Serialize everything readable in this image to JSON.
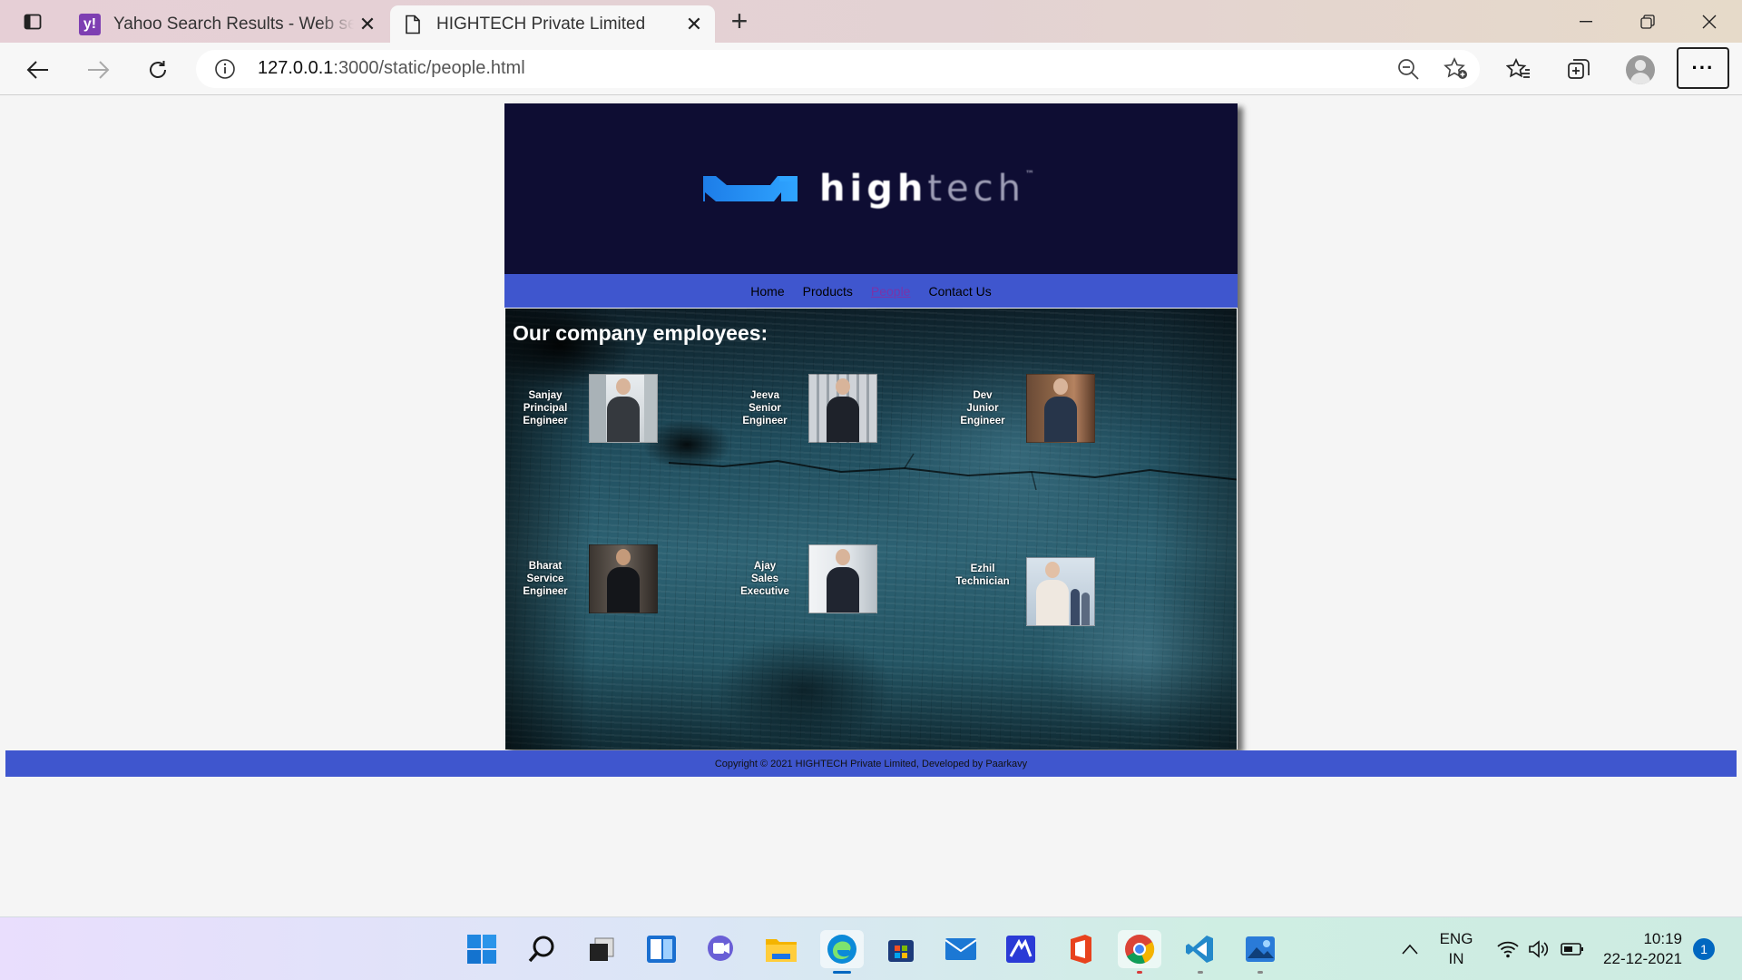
{
  "browser": {
    "tabs": [
      {
        "title": "Yahoo Search Results - Web search",
        "favicon": "yahoo-icon",
        "active": false
      },
      {
        "title": "HIGHTECH Private Limited",
        "favicon": "page-icon",
        "active": true
      }
    ],
    "url": {
      "host": "127.0.0.1",
      "rest": ":3000/static/people.html"
    }
  },
  "site": {
    "logo": {
      "strong": "high",
      "light": "tech",
      "tm": "™"
    },
    "nav": [
      {
        "label": "Home",
        "current": false
      },
      {
        "label": "Products",
        "current": false
      },
      {
        "label": "People",
        "current": true
      },
      {
        "label": "Contact Us",
        "current": false
      }
    ],
    "heading": "Our company employees:",
    "employees": [
      {
        "name": "Sanjay",
        "role1": "Principal",
        "role2": "Engineer"
      },
      {
        "name": "Jeeva",
        "role1": "Senior",
        "role2": "Engineer"
      },
      {
        "name": "Dev",
        "role1": "Junior",
        "role2": "Engineer"
      },
      {
        "name": "Bharat",
        "role1": "Service",
        "role2": "Engineer"
      },
      {
        "name": "Ajay",
        "role1": "Sales",
        "role2": "Executive"
      },
      {
        "name": "Ezhil",
        "role1": "Technician",
        "role2": ""
      }
    ],
    "footer": "Copyright © 2021 HIGHTECH Private Limited, Developed by Paarkavy"
  },
  "taskbar": {
    "apps": [
      "windows-start-icon",
      "search-icon",
      "task-view-icon",
      "widgets-icon",
      "chat-icon",
      "file-explorer-icon",
      "edge-icon",
      "store-icon",
      "mail-icon",
      "vscode-insiders-icon",
      "office-icon",
      "chrome-icon",
      "vscode-icon",
      "photos-icon"
    ],
    "lang_line1": "ENG",
    "lang_line2": "IN",
    "time": "10:19",
    "date": "22-12-2021",
    "notifications": "1"
  },
  "colors": {
    "nav_blue": "#3f56ce",
    "header_navy": "#0e0d33",
    "link_visited": "#7a34a8"
  }
}
